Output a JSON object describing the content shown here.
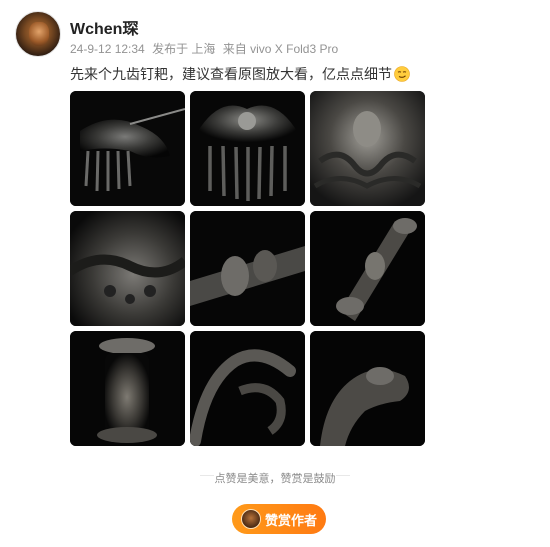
{
  "post": {
    "username": "Wchen琛",
    "timestamp": "24-9-12 12:34",
    "published_at": "发布于 上海",
    "source": "来自 vivo X Fold3 Pro",
    "text": "先来个九齿钉耙，建议查看原图放大看，亿点点细节",
    "emoji": "smirk-emoji"
  },
  "images": [
    {
      "name": "rake-dragon-side"
    },
    {
      "name": "rake-front-comb"
    },
    {
      "name": "buddha-face-detail"
    },
    {
      "name": "dragon-relief-detail"
    },
    {
      "name": "handle-dragon-closeup"
    },
    {
      "name": "handle-pillar-figures"
    },
    {
      "name": "handle-figure-statue"
    },
    {
      "name": "dragon-curve-handle"
    },
    {
      "name": "dragon-head-detail"
    }
  ],
  "footer": {
    "divider_text": "点赞是美意，赞赏是鼓励",
    "reward_label": "赞赏作者"
  },
  "colors": {
    "accent": "#ff8a18",
    "text_main": "#333333",
    "text_meta": "#939393"
  }
}
